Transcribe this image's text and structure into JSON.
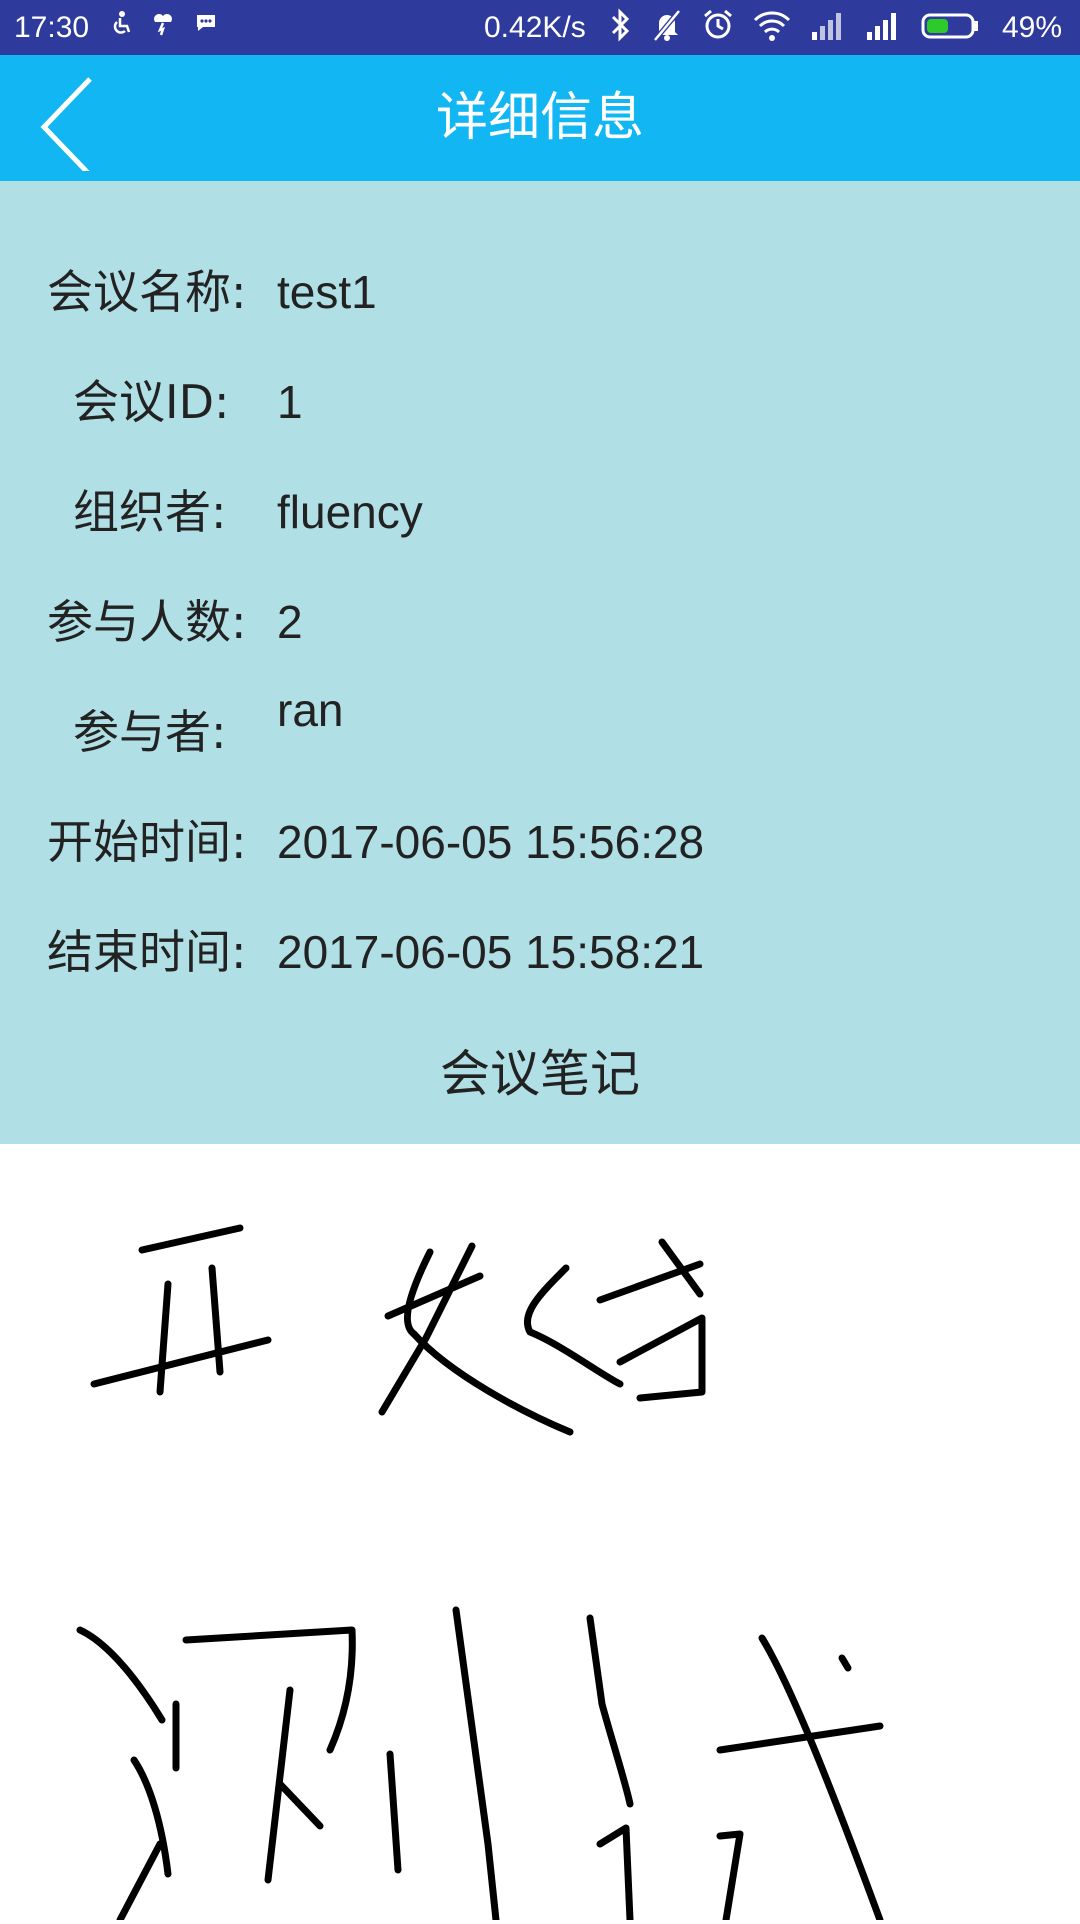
{
  "status_bar": {
    "time": "17:30",
    "net_speed": "0.42K/s",
    "battery_percent": "49%",
    "left_icons": [
      "accessibility-icon",
      "weather-icon",
      "message-icon"
    ],
    "right_icons": [
      "bluetooth-icon",
      "mute-icon",
      "alarm-icon",
      "wifi-icon",
      "signal-icon",
      "signal-icon",
      "battery-icon"
    ],
    "battery_level": 0.49
  },
  "app_bar": {
    "title": "详细信息",
    "back_icon": "chevron-left-icon"
  },
  "details": {
    "meeting_name_label": "会议名称:",
    "meeting_name_value": "test1",
    "meeting_id_label": "会议ID:",
    "meeting_id_value": "1",
    "organizer_label": "组织者:",
    "organizer_value": "fluency",
    "participant_count_label": "参与人数:",
    "participant_count_value": "2",
    "participants_label": "参与者:",
    "participants_value": "ran",
    "start_time_label": "开始时间:",
    "start_time_value": "2017-06-05 15:56:28",
    "end_time_label": "结束时间:",
    "end_time_value": "2017-06-05 15:58:21"
  },
  "notes": {
    "title": "会议笔记"
  },
  "colors": {
    "status_bar": "#2f3b9c",
    "app_bar": "#12b6f2",
    "info_panel": "#b0dfe5",
    "canvas": "#ffffff",
    "ink": "#000000"
  }
}
